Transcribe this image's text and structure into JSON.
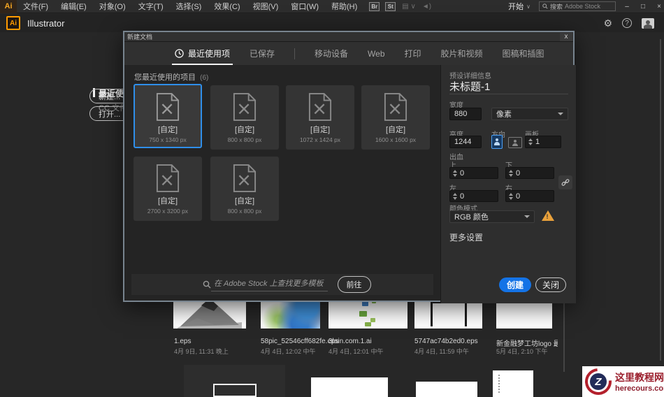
{
  "menubar": {
    "logo": "Ai",
    "items": [
      "文件(F)",
      "编辑(E)",
      "对象(O)",
      "文字(T)",
      "选择(S)",
      "效果(C)",
      "视图(V)",
      "窗口(W)",
      "帮助(H)"
    ],
    "badges": [
      "Br",
      "St"
    ],
    "start_label": "开始",
    "search_prefix": "搜索",
    "search_placeholder": "Adobe Stock"
  },
  "appbar": {
    "logo": "Ai",
    "title": "Illustrator"
  },
  "home": {
    "nav_recent": "最近使",
    "nav_cc": "CC 文件",
    "new_button": "新建...",
    "open_button": "打开...",
    "files": [
      {
        "name": "1.eps",
        "date": "4月 9日, 11:31 晚上"
      },
      {
        "name": "58pic_52546cff682fe.eps",
        "date": "4月 4日, 12:02 中午"
      },
      {
        "name": "3lain.com.1.ai",
        "date": "4月 4日, 12:01 中午"
      },
      {
        "name": "5747ac74b2ed0.eps",
        "date": "4月 4日, 11:59 中午"
      },
      {
        "name": "新金融梦工坊logo 最终定...",
        "date": "5月 4日, 2:10 下午"
      }
    ]
  },
  "dialog": {
    "title": "新建文档",
    "close_icon": "x",
    "tabs": [
      {
        "label": "最近使用项"
      },
      {
        "label": "已保存"
      },
      {
        "label": "移动设备"
      },
      {
        "label": "Web"
      },
      {
        "label": "打印"
      },
      {
        "label": "胶片和视频"
      },
      {
        "label": "图稿和插图"
      }
    ],
    "recent_header": "您最近使用的项目",
    "recent_count": "(6)",
    "presets": [
      {
        "label": "[自定]",
        "size": "750 x 1340 px"
      },
      {
        "label": "[自定]",
        "size": "800 x 800 px"
      },
      {
        "label": "[自定]",
        "size": "1072 x 1424 px"
      },
      {
        "label": "[自定]",
        "size": "1600 x 1600 px"
      },
      {
        "label": "[自定]",
        "size": "2700 x 3200 px"
      },
      {
        "label": "[自定]",
        "size": "800 x 800 px"
      }
    ],
    "stock_search_text": "在 Adobe Stock 上查找更多模板",
    "go_button": "前往",
    "details": {
      "header": "预设详细信息",
      "doc_name": "未标题-1",
      "width_label": "宽度",
      "width_value": "880",
      "unit_value": "像素",
      "height_label": "高度",
      "height_value": "1244",
      "orientation_label": "方向",
      "artboard_label": "画板",
      "artboard_value": "1",
      "bleed_label": "出血",
      "bleed_top_label": "上",
      "bleed_top_value": "0",
      "bleed_bottom_label": "下",
      "bleed_bottom_value": "0",
      "bleed_left_label": "左",
      "bleed_left_value": "0",
      "bleed_right_label": "右",
      "bleed_right_value": "0",
      "color_mode_label": "颜色模式",
      "color_mode_value": "RGB 颜色",
      "more_settings": "更多设置",
      "create_button": "创建",
      "close_button": "关闭"
    }
  },
  "watermark": {
    "logo_letter": "Z",
    "site_name": "这里教程网",
    "site_url": "herecours.com"
  },
  "icons": {
    "gear": "⚙",
    "help": "?",
    "minimize": "–",
    "maximize": "□",
    "close": "×",
    "chevron_down": "∨"
  },
  "colors": {
    "accent_blue": "#1473e6",
    "selection_blue": "#2f8fea",
    "warning_orange": "#e9a13b",
    "logo_orange": "#ff9a00",
    "watermark_red": "#9b1f2d"
  }
}
